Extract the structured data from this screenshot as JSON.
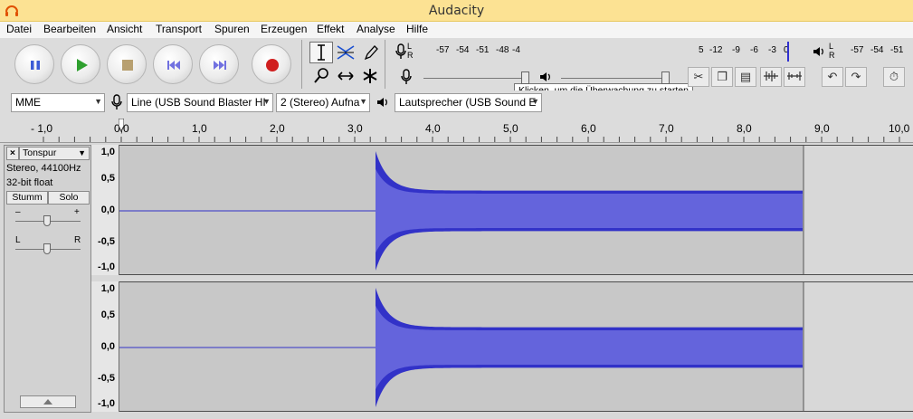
{
  "window": {
    "title": "Audacity"
  },
  "menu": [
    "Datei",
    "Bearbeiten",
    "Ansicht",
    "Transport",
    "Spuren",
    "Erzeugen",
    "Effekt",
    "Analyse",
    "Hilfe"
  ],
  "meters": {
    "record_label_top": "L",
    "record_label_bottom": "R",
    "record_scale": [
      "-57",
      "-54",
      "-51",
      "-48",
      "-4",
      "5",
      "-12",
      "-9",
      "-6",
      "-3",
      "0"
    ],
    "playback_label_top": "L",
    "playback_label_bottom": "R",
    "playback_scale": [
      "-57",
      "-54",
      "-51"
    ],
    "tooltip": "Klicken, um die Überwachung zu starten"
  },
  "devices": {
    "host": "MME",
    "input": "Line (USB Sound Blaster HI",
    "channels": "2 (Stereo) Aufna",
    "output": "Lautsprecher (USB Sound E"
  },
  "ruler": {
    "labels": [
      "- 1,0",
      "0,0",
      "1,0",
      "2,0",
      "3,0",
      "4,0",
      "5,0",
      "6,0",
      "7,0",
      "8,0",
      "9,0",
      "10,0"
    ]
  },
  "track": {
    "name": "Tonspur",
    "info_rate": "Stereo, 44100Hz",
    "info_format": "32-bit float",
    "mute": "Stumm",
    "solo": "Solo",
    "gain_minus": "–",
    "gain_plus": "+",
    "pan_left": "L",
    "pan_right": "R",
    "close": "×",
    "axis_labels": [
      "1,0",
      "0,5",
      "0,0",
      "-0,5",
      "-1,0"
    ]
  },
  "colors": {
    "waveform": "#3232c8",
    "waveform_rms": "#6464dc",
    "selection": "#c8c8c8",
    "background": "#d8d8d8"
  }
}
